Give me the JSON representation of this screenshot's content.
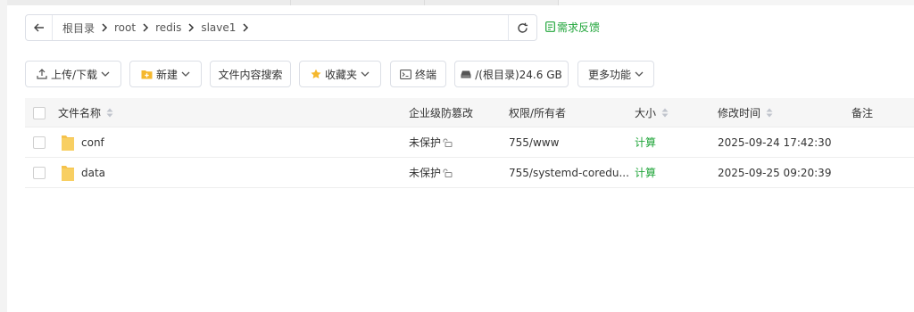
{
  "path": {
    "crumbs": [
      "根目录",
      "root",
      "redis",
      "slave1"
    ]
  },
  "feedback": {
    "label": "需求反馈"
  },
  "toolbar": {
    "upload_download": "上传/下载",
    "new": "新建",
    "content_search": "文件内容搜索",
    "favorites": "收藏夹",
    "terminal": "终端",
    "disk": "/(根目录)24.6 GB",
    "more": "更多功能"
  },
  "table": {
    "headers": {
      "name": "文件名称",
      "tamper": "企业级防篡改",
      "perm": "权限/所有者",
      "size": "大小",
      "mtime": "修改时间",
      "note": "备注"
    },
    "rows": [
      {
        "name": "conf",
        "tamper": "未保护",
        "perm": "755/www",
        "size": "计算",
        "mtime": "2025-09-24 17:42:30",
        "note": ""
      },
      {
        "name": "data",
        "tamper": "未保护",
        "perm": "755/systemd-coredu...",
        "size": "计算",
        "mtime": "2025-09-25 09:20:39",
        "note": ""
      }
    ]
  },
  "colors": {
    "accent": "#20a53a",
    "folder": "#f5c24c",
    "border": "#dcdfe6"
  }
}
